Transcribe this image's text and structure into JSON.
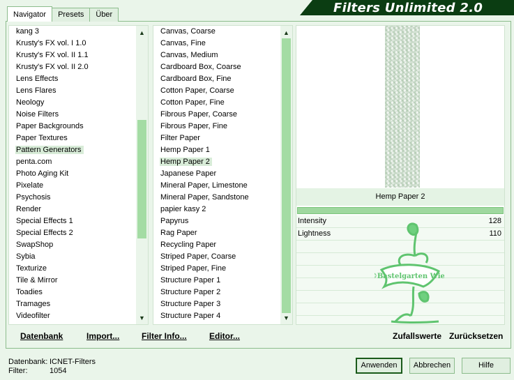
{
  "app": {
    "title": "Filters Unlimited 2.0"
  },
  "tabs": [
    {
      "label": "Navigator",
      "active": true
    },
    {
      "label": "Presets",
      "active": false
    },
    {
      "label": "Über",
      "active": false
    }
  ],
  "categories": {
    "selected_index": 10,
    "scroll_fraction": 0.5,
    "items": [
      "kang 3",
      "Krusty's FX vol. I 1.0",
      "Krusty's FX vol. II 1.1",
      "Krusty's FX vol. II 2.0",
      "Lens Effects",
      "Lens Flares",
      "Neology",
      "Noise Filters",
      "Paper Backgrounds",
      "Paper Textures",
      "Pattern Generators",
      "penta.com",
      "Photo Aging Kit",
      "Pixelate",
      "Psychosis",
      "Render",
      "Special Effects 1",
      "Special Effects 2",
      "SwapShop",
      "Sybia",
      "Texturize",
      "Tile & Mirror",
      "Toadies",
      "Tramages",
      "Videofilter"
    ]
  },
  "filters": {
    "selected_index": 11,
    "items": [
      "Canvas, Coarse",
      "Canvas, Fine",
      "Canvas, Medium",
      "Cardboard Box, Coarse",
      "Cardboard Box, Fine",
      "Cotton Paper, Coarse",
      "Cotton Paper, Fine",
      "Fibrous Paper, Coarse",
      "Fibrous Paper, Fine",
      "Filter Paper",
      "Hemp Paper 1",
      "Hemp Paper 2",
      "Japanese Paper",
      "Mineral Paper, Limestone",
      "Mineral Paper, Sandstone",
      "papier kasy 2",
      "Papyrus",
      "Rag Paper",
      "Recycling Paper",
      "Striped Paper, Coarse",
      "Striped Paper, Fine",
      "Structure Paper 1",
      "Structure Paper 2",
      "Structure Paper 3",
      "Structure Paper 4"
    ]
  },
  "preview": {
    "filter_name": "Hemp Paper 2",
    "progress": 1.0,
    "params": [
      {
        "label": "Intensity",
        "value": "128"
      },
      {
        "label": "Lightness",
        "value": "110"
      }
    ],
    "watermark_text": "©Bastelgarten Wien"
  },
  "toolbar": {
    "datenbank": "Datenbank",
    "import": "Import...",
    "filter_info": "Filter Info...",
    "editor": "Editor...",
    "zufallswerte": "Zufallswerte",
    "zuruecksetzen": "Zurücksetzen"
  },
  "status": {
    "db_label": "Datenbank:",
    "db_value": "ICNET-Filters",
    "filter_label": "Filter:",
    "filter_value": "1054"
  },
  "buttons": {
    "apply": "Anwenden",
    "cancel": "Abbrechen",
    "help": "Hilfe"
  },
  "colors": {
    "accent": "#a4dca4",
    "banner": "#0b3d12",
    "background": "#eaf5ea"
  }
}
